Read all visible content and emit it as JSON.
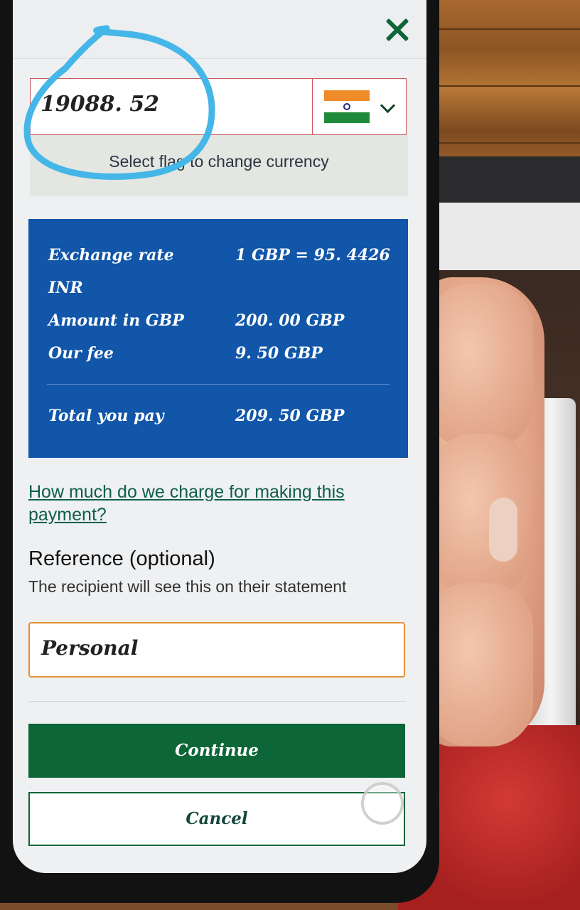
{
  "amount": {
    "value": "19088. 52",
    "currency_flag": "india-flag-icon",
    "hint": "Select flag to change currency"
  },
  "summary": {
    "rows": [
      {
        "label": "Exchange rate",
        "value": "1 GBP = 95. 4426"
      },
      {
        "label": "INR",
        "value": ""
      },
      {
        "label": "Amount in GBP",
        "value": "200. 00 GBP"
      },
      {
        "label": "Our fee",
        "value": "9. 50 GBP"
      }
    ],
    "total": {
      "label": "Total you pay",
      "value": "209. 50 GBP"
    }
  },
  "fee_link": "How much do we charge for making this payment?",
  "reference": {
    "title": "Reference (optional)",
    "subtitle": "The recipient will see this on their statement",
    "value": "Personal"
  },
  "buttons": {
    "continue": "Continue",
    "cancel": "Cancel"
  },
  "colors": {
    "brand_green": "#0d6637",
    "summary_blue": "#1156a8",
    "input_focus": "#e38f36",
    "annotation": "#45b6e8"
  }
}
